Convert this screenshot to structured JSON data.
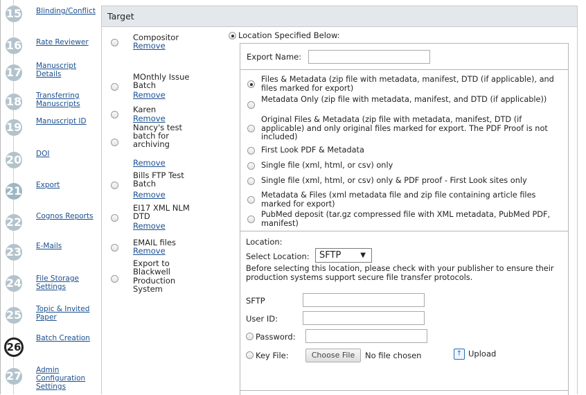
{
  "nav": {
    "steps": [
      {
        "num": "15",
        "label": "Blinding/Conflict",
        "state": "completed"
      },
      {
        "num": "16",
        "label": "Rate Reviewer",
        "state": "completed"
      },
      {
        "num": "17",
        "label": "Manuscript Details",
        "state": "completed"
      },
      {
        "num": "18",
        "label": "Transferring Manuscripts",
        "state": "completed"
      },
      {
        "num": "19",
        "label": "Manuscript ID",
        "state": "completed"
      },
      {
        "num": "20",
        "label": "DOI",
        "state": "completed"
      },
      {
        "num": "21",
        "label": "Export",
        "state": "highlighted"
      },
      {
        "num": "22",
        "label": "Cognos Reports",
        "state": "completed"
      },
      {
        "num": "23",
        "label": "E-Mails",
        "state": "completed"
      },
      {
        "num": "24",
        "label": "File Storage Settings",
        "state": "completed"
      },
      {
        "num": "25",
        "label": "Topic & Invited Paper",
        "state": "completed"
      },
      {
        "num": "26",
        "label": "Batch Creation",
        "state": "current"
      },
      {
        "num": "27",
        "label": "Admin Configuration Settings",
        "state": "completed"
      }
    ]
  },
  "target": {
    "header": "Target",
    "remove_label": "Remove",
    "batches": [
      {
        "name": "Compositor"
      },
      {
        "name": "MOnthly Issue Batch"
      },
      {
        "name": "Karen"
      },
      {
        "name": "Nancy's test batch for archiving"
      },
      {
        "name": "Bills FTP Test Batch"
      },
      {
        "name": "EI17 XML NLM DTD"
      },
      {
        "name": "EMAIL files"
      },
      {
        "name": "Export to Blackwell Production System"
      }
    ],
    "location_specified_label": "Location Specified Below:",
    "export_name_label": "Export Name:",
    "export_name_value": "",
    "options": [
      {
        "text": "Files & Metadata (zip file with metadata, manifest, DTD (if applicable), and files marked for export)",
        "selected": true
      },
      {
        "text": "Metadata Only (zip file with metadata, manifest, and DTD (if applicable))",
        "selected": false
      },
      {
        "text": "Original Files & Metadata (zip file with metadata, manifest, DTD (if applicable) and only original files marked for export. The PDF Proof is not included)",
        "selected": false
      },
      {
        "text": "First Look PDF & Metadata",
        "selected": false
      },
      {
        "text": "Single file (xml, html, or csv) only",
        "selected": false
      },
      {
        "text": "Single file (xml, html, or csv) only & PDF proof - First Look sites only",
        "selected": false
      },
      {
        "text": "Metadata & Files (xml metadata file and zip file containing article files marked for export)",
        "selected": false
      },
      {
        "text": "PubMed deposit (tar.gz compressed file with XML metadata, PubMed PDF, manifest)",
        "selected": false
      }
    ],
    "location": {
      "label": "Location:",
      "select_label": "Select Location:",
      "selected": "SFTP",
      "arrow": "▼",
      "notice": "Before selecting this location, please check with your publisher to ensure their production systems support secure file transfer protocols.",
      "sftp_label": "SFTP",
      "sftp_value": "",
      "userid_label": "User ID:",
      "userid_value": "",
      "password_label": "Password:",
      "password_value": "",
      "keyfile_label": "Key File:",
      "choose_file_label": "Choose File",
      "no_file_label": "No file chosen",
      "upload_label": "Upload",
      "upload_icon": "↑"
    }
  }
}
